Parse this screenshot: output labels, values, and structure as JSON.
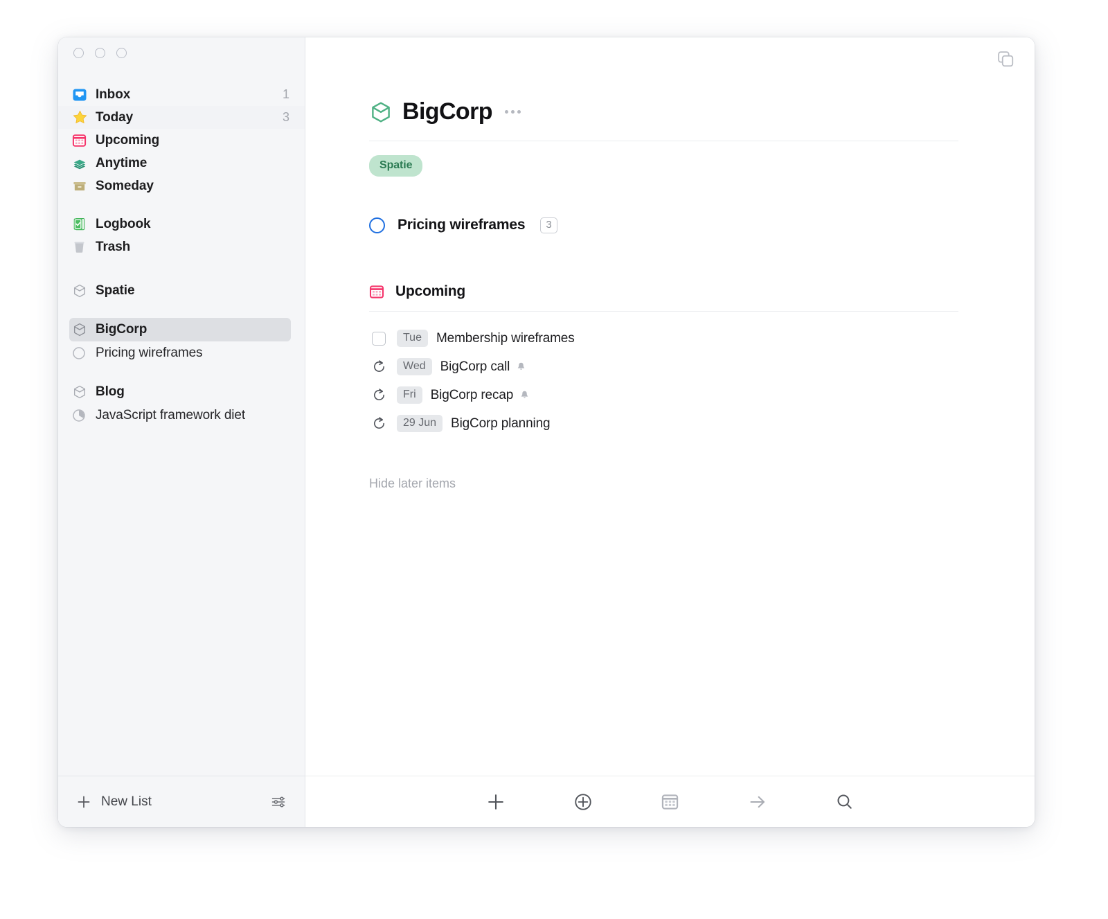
{
  "window": {
    "traffic_lights": [
      "close",
      "minimize",
      "zoom"
    ],
    "quick_entry_icon": "copy-windows-icon"
  },
  "sidebar": {
    "nav": [
      {
        "label": "Inbox",
        "count": "1",
        "icon": "inbox-icon",
        "selected": false
      },
      {
        "label": "Today",
        "count": "3",
        "icon": "star-icon",
        "selected": true
      },
      {
        "label": "Upcoming",
        "count": "",
        "icon": "calendar-icon",
        "selected": false
      },
      {
        "label": "Anytime",
        "count": "",
        "icon": "layers-icon",
        "selected": false
      },
      {
        "label": "Someday",
        "count": "",
        "icon": "box-icon",
        "selected": false
      }
    ],
    "nav2": [
      {
        "label": "Logbook",
        "count": "",
        "icon": "logbook-icon"
      },
      {
        "label": "Trash",
        "count": "",
        "icon": "trash-icon"
      }
    ],
    "areas": [
      {
        "label": "Spatie",
        "icon": "area-hex-icon",
        "active": false,
        "children": []
      },
      {
        "label": "BigCorp",
        "icon": "area-hex-icon",
        "active": true,
        "children": [
          {
            "label": "Pricing wireframes",
            "icon": "project-circle-icon",
            "progress": 0
          }
        ]
      },
      {
        "label": "Blog",
        "icon": "area-hex-icon",
        "active": false,
        "children": [
          {
            "label": "JavaScript framework diet",
            "icon": "project-pie-icon",
            "progress": 45
          }
        ]
      }
    ],
    "footer": {
      "new_list_label": "New List",
      "new_list_icon": "plus-icon",
      "settings_icon": "sliders-icon"
    }
  },
  "main": {
    "project": {
      "title": "BigCorp",
      "icon": "project-hex-icon",
      "menu_icon": "ellipsis-icon",
      "tags": [
        "Spatie"
      ]
    },
    "todos": [
      {
        "title": "Pricing wireframes",
        "badge": "3",
        "icon": "open-circle-icon"
      }
    ],
    "upcoming": {
      "heading": "Upcoming",
      "icon": "calendar-icon",
      "items": [
        {
          "date": "Tue",
          "title": "Membership wireframes",
          "lead_icon": "checkbox-icon",
          "reminder": false
        },
        {
          "date": "Wed",
          "title": "BigCorp call",
          "lead_icon": "repeat-icon",
          "reminder": true
        },
        {
          "date": "Fri",
          "title": "BigCorp recap",
          "lead_icon": "repeat-icon",
          "reminder": true
        },
        {
          "date": "29 Jun",
          "title": "BigCorp planning",
          "lead_icon": "repeat-icon",
          "reminder": false
        }
      ],
      "hide_later_label": "Hide later items"
    },
    "footer_tools": [
      {
        "name": "new-todo-button",
        "icon": "plus-icon"
      },
      {
        "name": "new-heading-button",
        "icon": "circle-plus-icon"
      },
      {
        "name": "when-button",
        "icon": "calendar-icon"
      },
      {
        "name": "move-button",
        "icon": "arrow-right-icon"
      },
      {
        "name": "search-button",
        "icon": "search-icon"
      }
    ]
  },
  "colors": {
    "accent_blue": "#1f6fe0",
    "tag_green_bg": "#bfe4ce",
    "tag_green_fg": "#2b7a52",
    "sidebar_bg": "#f5f6f8",
    "selection_gray": "#dddfe3",
    "pink_calendar": "#f5356b"
  }
}
